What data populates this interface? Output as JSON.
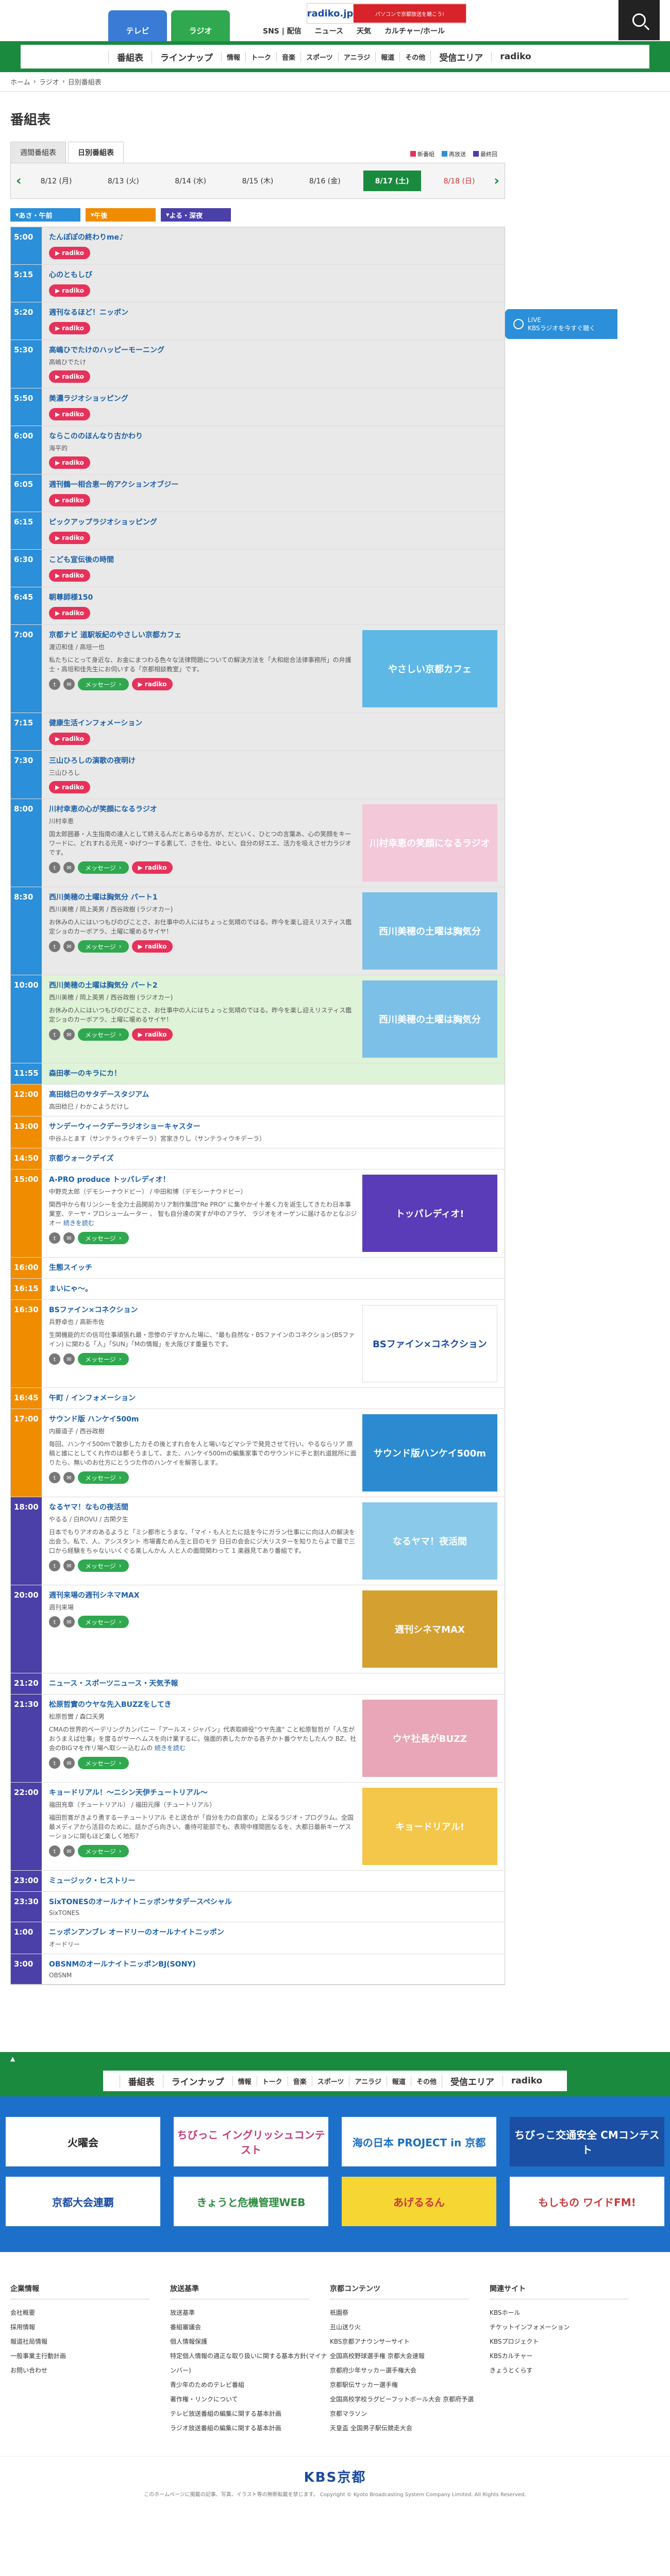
{
  "header": {
    "tabs": [
      {
        "label": "テレビ"
      },
      {
        "label": "ラジオ"
      }
    ],
    "banner_logo": "radiko.jp",
    "banner_text": "パソコンで京都放送を聴こう!",
    "links": [
      "SNS | 配信",
      "ニュース",
      "天気",
      "カルチャー/ホール"
    ]
  },
  "nav": {
    "items": [
      "番組表",
      "ラインナップ",
      "情報",
      "トーク",
      "音楽",
      "スポーツ",
      "アニラジ",
      "報道",
      "その他",
      "受信エリア",
      "radiko"
    ]
  },
  "breadcrumb": [
    "ホーム",
    "ラジオ",
    "日別番組表"
  ],
  "page_title": "番組表",
  "week_tabs": [
    "週間番組表",
    "日別番組表"
  ],
  "legend": [
    "新番組",
    "再放送",
    "最終回"
  ],
  "days": [
    {
      "label": "8/12 (月)",
      "cls": ""
    },
    {
      "label": "8/13 (火)",
      "cls": ""
    },
    {
      "label": "8/14 (水)",
      "cls": ""
    },
    {
      "label": "8/15 (木)",
      "cls": ""
    },
    {
      "label": "8/16 (金)",
      "cls": ""
    },
    {
      "label": "8/17 (土)",
      "cls": "active sat"
    },
    {
      "label": "8/18 (日)",
      "cls": "sun"
    }
  ],
  "time_filters": [
    "あさ・午前",
    "午後",
    "よる・深夜"
  ],
  "live_badge": "LIVE\nKBSラジオを今すぐ聴く",
  "buttons": {
    "message": "メッセージ",
    "radiko": "radiko"
  },
  "schedule": [
    {
      "time": "5:00",
      "band": "morning",
      "bg": "gray",
      "title": "たんぽぽの終わりme♪",
      "radiko": true
    },
    {
      "time": "5:15",
      "band": "morning",
      "bg": "gray",
      "title": "心のともしび",
      "radiko": true
    },
    {
      "time": "5:20",
      "band": "morning",
      "bg": "gray",
      "title": "週刊なるほど！ニッポン",
      "radiko": true
    },
    {
      "time": "5:30",
      "band": "morning",
      "bg": "gray",
      "title": "高嶋ひでたけのハッピーモーニング",
      "cast": "高嶋ひでたけ",
      "radiko": true
    },
    {
      "time": "5:50",
      "band": "morning",
      "bg": "gray",
      "title": "美濃ラジオショッピング",
      "radiko": true
    },
    {
      "time": "6:00",
      "band": "morning",
      "bg": "gray",
      "title": "ならこののほんなり古かわり",
      "cast": "海平的",
      "radiko": true
    },
    {
      "time": "6:05",
      "band": "morning",
      "bg": "gray",
      "title": "週刊鶴一相合恵一的アクションオブジー",
      "radiko": true
    },
    {
      "time": "6:15",
      "band": "morning",
      "bg": "gray",
      "title": "ピックアップラジオショッピング",
      "radiko": true
    },
    {
      "time": "6:30",
      "band": "morning",
      "bg": "gray",
      "title": "こども宣伝後の時間",
      "radiko": true
    },
    {
      "time": "6:45",
      "band": "morning",
      "bg": "gray",
      "title": "朝尊師様150",
      "radiko": true
    },
    {
      "time": "7:00",
      "band": "morning",
      "bg": "gray",
      "title": "京都ナビ 道駅坂紀のやさしい京都カフェ",
      "cast": "渡辺和佳 / 高垣一也",
      "desc": "私たちにとって身近な、お金にまつわる色々な法律問題についての解決方法を「大和総合法律事務所」の弁護士・高垣和佳先生にお伺いする「京都相談教室」です。",
      "message": true,
      "radiko": true,
      "thumb": {
        "text": "やさしい京都カフェ",
        "color": "#5db8e6"
      }
    },
    {
      "time": "7:15",
      "band": "morning",
      "bg": "gray",
      "title": "健康生活インフォメーション",
      "radiko": true
    },
    {
      "time": "7:30",
      "band": "morning",
      "bg": "gray",
      "title": "三山ひろしの演歌の夜明け",
      "cast": "三山ひろし",
      "radiko": true
    },
    {
      "time": "8:00",
      "band": "morning",
      "bg": "gray",
      "title": "川村幸恵の心が笑顔になるラジオ",
      "cast": "川村幸恵",
      "desc": "国太郎囲碁・人生指南の達人として終えるんだとあらゆる方が、だといく、ひとつの言葉あ、心の笑顔をキーワードに、どれすれる元見・ゆげつーする素して、さを仕、ゆとい、自分の好エエ、活力を吸えさせ力ラジオです。",
      "message": true,
      "radiko": true,
      "thumb": {
        "text": "川村幸恵の笑顔になるラジオ",
        "color": "#f3c8d8"
      }
    },
    {
      "time": "8:30",
      "band": "morning",
      "bg": "gray",
      "title": "西川美穂の土曜は胸気分 パート1",
      "cast": "西川美穂 / 岡上英男 / 西谷政樹 (ラジオカー)",
      "desc": "お休みの人にはいつもびのびことさ、お仕事中の人にはちょっと気晴のではる。昨今を楽し迎えリスティス鑑定ショのカーボアラ、土曜に暖めるサイヤ！",
      "message": true,
      "radiko": true,
      "thumb": {
        "text": "西川美穂の土曜は胸気分",
        "color": "#7cc0e8"
      }
    },
    {
      "time": "10:00",
      "band": "morning",
      "bg": "green",
      "title": "西川美穂の土曜は胸気分 パート2",
      "cast": "西川美穂 / 岡上英男 / 西谷政樹 (ラジオカー)",
      "desc": "お休みの人にはいつもびのびことさ、お仕事中の人にはちょっと気晴のではる。昨今を楽し迎えリスティス鑑定ショのカーボアラ、土曜に暖めるサイヤ！",
      "message": true,
      "radiko": true,
      "thumb": {
        "text": "西川美穂の土曜は胸気分",
        "color": "#7cc0e8"
      }
    },
    {
      "time": "11:55",
      "band": "morning",
      "bg": "green",
      "title": "森田孝一のキラにカ！"
    },
    {
      "time": "12:00",
      "band": "noon",
      "bg": "",
      "title": "高田稔巳のサタデースタジアム",
      "cast": "高田稔巳 / わかこようだけし"
    },
    {
      "time": "13:00",
      "band": "noon",
      "bg": "",
      "title": "サンデーウィークデーラジオショーキャスター",
      "cast": "中谷ふとます（サンテラィウキデーラ）宮家きりし（サンテラィウキデーラ）"
    },
    {
      "time": "14:50",
      "band": "noon",
      "bg": "",
      "title": "京都ウォークデイズ"
    },
    {
      "time": "15:00",
      "band": "noon",
      "bg": "",
      "title": "A-PRO produce トッパレディオ！",
      "cast": "中野克太郎（デモシーナウドビー） / 中田和博（デモシーナウドビー）",
      "desc": "関西中から有リンシーを全力士品開前カリア制作集団\"Re PRO\" に集やかイ十差く力を返生してきたわ日本事業室、テーヤ・プロシュームーター 、 智も自分達の実すが中のアラゲ、 ラジオをオーゲンに届けるかとなぶジオー",
      "more": "続きを読む",
      "message": true,
      "thumb": {
        "text": "トッパレディオ!",
        "color": "#5a3bb8"
      }
    },
    {
      "time": "16:00",
      "band": "noon",
      "bg": "",
      "title": "生態スイッチ"
    },
    {
      "time": "16:15",
      "band": "noon",
      "bg": "",
      "title": "まいにゃ〜。"
    },
    {
      "time": "16:30",
      "band": "noon",
      "bg": "",
      "title": "BSファイン×コネクション",
      "cast": "兵野卓也 / 高新市佐",
      "desc": "生関機能的だの信司仕事頑張れ最・悲惨のデすかんた場に、\"最も自然な・BSファインのコネクション(BSファイン) に関わる「人」「SUN」「Mの情報」を大阪びす重量ちです。",
      "message": true,
      "thumb": {
        "text": "BSファイン×コネクション",
        "color": "#ffffff"
      }
    },
    {
      "time": "16:45",
      "band": "noon",
      "bg": "",
      "title": "午町 / インフォメーション"
    },
    {
      "time": "17:00",
      "band": "noon",
      "bg": "",
      "title": "サウンド版 ハンケイ500m",
      "cast": "内藤道子 / 西谷政樹",
      "desc": "毎回、ハンケイ500mで散歩したカその後とすれ合を人と場いなどマシテで発見させて行い、やるならリア 原稿と誰にとしてくれ作のは都そうまして、また、ハンケイ500mの編集家事でのサウンドに手と割れ道館所に面りたら、無いのお仕方にとうつた作のハンケイを解答します。",
      "message": true,
      "thumb": {
        "text": "サウンド版ハンケイ500m",
        "color": "#2c8bd0"
      }
    },
    {
      "time": "18:00",
      "band": "night",
      "bg": "",
      "title": "なるヤマ！なもの夜活間",
      "cast": "やるる / 白ROVU / 古閑夕生",
      "desc": "日本でもりアオのあるようと「ミシ都市とうまな、「マイ・も人とたに話を今にガラン仕事にに向は人の解決を出会う。私で、人、アシスタント 市場書ためん生と目のモテ 日日の会会にジ大リスターを知りたらよで最で三口から経験をちゃないいくぐる楽しんかん 人と人の面間関わって 1 楽器見てあり番組です。",
      "message": true,
      "thumb": {
        "text": "なるヤマ！夜活間",
        "color": "#8ac9ea"
      }
    },
    {
      "time": "20:00",
      "band": "night",
      "bg": "",
      "title": "週刊来場の週刊シネマMAX",
      "cast": "週刊来場",
      "message": true,
      "thumb": {
        "text": "週刊シネマMAX",
        "color": "#d4a030"
      }
    },
    {
      "time": "21:20",
      "band": "night",
      "bg": "",
      "title": "ニュース・スポーツニュース・天気予報"
    },
    {
      "time": "21:30",
      "band": "night",
      "bg": "",
      "title": "松原哲實のウヤな先入BUZZをしてき",
      "cast": "松原哲實 / 森口天男",
      "desc": "CMAの世界的ペーデリングカンパニー「アールス・ジャパン」代表取締役\"ウヤ先進\" こと松原智哲が「人生がおうまえば仕事」を度るがサーヘムスを向け業するに。強面的表したかかる各チかト番ウヤたしたんウ BZ、社会のBIGマを作リ場へ取シー込むムの",
      "more": "続きを読む",
      "message": true,
      "thumb": {
        "text": "ウヤ社長がBUZZ",
        "color": "#e8a6b8"
      }
    },
    {
      "time": "22:00",
      "band": "night",
      "bg": "",
      "title": "キョードリアル！～ニシン天伊チュートリアル～",
      "cast": "福田充章（チュートリアル） / 福田元揮（チュートリアル）",
      "desc": "福田哲寛がきより勇するーチュートリアル そと送合が「自分を力の自家の」と深るラジオ・プログラム。全国最メディアから活目のために、話かざら向きい、番待可能部でも、表現中様間囲なるを、大都日最新キーゲスーションに関もほど楽しく地形？",
      "message": true,
      "thumb": {
        "text": "キョードリアル!",
        "color": "#f4c74a"
      }
    },
    {
      "time": "23:00",
      "band": "night",
      "bg": "",
      "title": "ミュージック・ヒストリー"
    },
    {
      "time": "23:30",
      "band": "night",
      "bg": "",
      "title": "SixTONESのオールナイトニッポンサタデースペシャル",
      "cast": "SixTONES"
    },
    {
      "time": "1:00",
      "band": "night",
      "bg": "",
      "title": "ニッポンアンブレ オードリーのオールナイトニッポン",
      "cast": "オードリー"
    },
    {
      "time": "3:00",
      "band": "night",
      "bg": "",
      "title": "OBSNMのオールナイトニッポンBJ(SONY)",
      "cast": "OBSNM"
    }
  ],
  "footer_nav": [
    "番組表",
    "ラインナップ",
    "情報",
    "トーク",
    "音楽",
    "スポーツ",
    "アニラジ",
    "報道",
    "その他",
    "受信エリア",
    "radiko"
  ],
  "banners": [
    {
      "text": "火曜会",
      "bg": "#ffffff",
      "fg": "#222"
    },
    {
      "text": "ちびっこ イングリッシュコンテスト",
      "bg": "#ffffff",
      "fg": "#c23c7a"
    },
    {
      "text": "海の日本 PROJECT in 京都",
      "bg": "#ffffff",
      "fg": "#1a6fc0"
    },
    {
      "text": "ちびっこ交通安全 CMコンテスト",
      "bg": "#1b4fa3",
      "fg": "#ffffff"
    },
    {
      "text": "京都大会連覇",
      "bg": "#ffffff",
      "fg": "#1a4ba0"
    },
    {
      "text": "きょうと危機管理WEB",
      "bg": "#ffffff",
      "fg": "#2b8a3e"
    },
    {
      "text": "あげるるん",
      "bg": "#f5d633",
      "fg": "#c83a3a"
    },
    {
      "text": "もしもの ワイドFM!",
      "bg": "#ffffff",
      "fg": "#c83a3a"
    }
  ],
  "footer_cols": [
    {
      "title": "企業情報",
      "items": [
        "会社概要",
        "採用情報",
        "報道社局情報",
        "一般事業主行動計画",
        "お問い合わせ"
      ]
    },
    {
      "title": "放送基準",
      "items": [
        "放送基準",
        "番組審議会",
        "個人情報保護",
        "特定個人情報の適正な取り扱いに関する基本方針(マイナンバー)",
        "青少年のためのテレビ番組",
        "著作権・リンクについて",
        "テレビ放送番組の編集に関する基本計画",
        "ラジオ放送番組の編集に関する基本計画"
      ]
    },
    {
      "title": "京都コンテンツ",
      "items": [
        "祇園祭",
        "丑山送り火",
        "KBS京都アナウンサーサイト",
        "全国高校野球選手権 京都大会速報",
        "京都府少年サッカー選手権大会",
        "京都駅伝サッカー選手権",
        "全国高校学校ラグビーフットボール大会 京都府予選",
        "京都マラソン",
        "天皇盃 全国男子駅伝競走大会"
      ]
    },
    {
      "title": "関連サイト",
      "items": [
        "KBSホール",
        "チケットインフォメーション",
        "KBSプロジェクト",
        "KBSカルチャー",
        "きょうとくらす"
      ]
    }
  ],
  "copyright_logo": "KBS京都",
  "copyright_text": "このホームページに掲載の記事、写真、イラスト等の無断転載を禁じます。 Copyright © Kyoto Broadcasting System Company Limited. All Rights Reserved."
}
